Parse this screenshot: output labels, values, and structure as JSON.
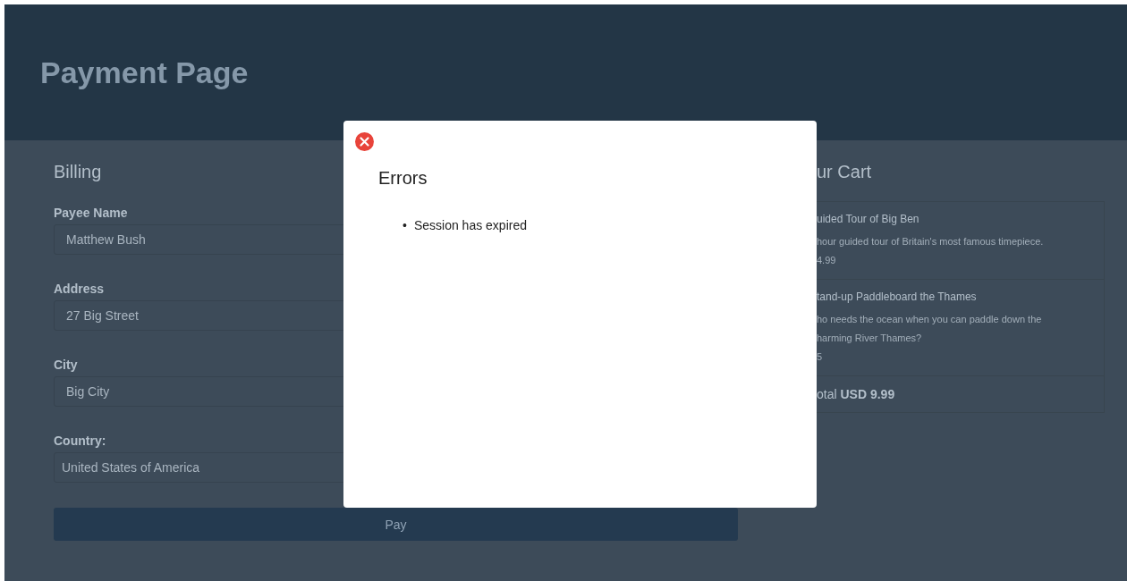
{
  "header": {
    "title": "Payment Page"
  },
  "billing": {
    "heading": "Billing",
    "fields": [
      {
        "label": "Payee Name",
        "value": "Matthew Bush"
      },
      {
        "label": "Address",
        "value": "27 Big Street"
      },
      {
        "label": "City",
        "value": "Big City"
      },
      {
        "label": "Country:",
        "value": "United States of America"
      }
    ],
    "pay_button": "Pay"
  },
  "cart": {
    "heading": "ur Cart",
    "items": [
      {
        "name": "uided Tour of Big Ben",
        "description_lines": [
          "hour guided tour of Britain's most famous timepiece."
        ],
        "price": "4.99"
      },
      {
        "name": "tand-up Paddleboard the Thames",
        "description_lines": [
          "ho needs the ocean when you can paddle down the",
          "harming River Thames?"
        ],
        "price": "5"
      }
    ],
    "total_label": "otal",
    "total_value": "USD 9.99"
  },
  "dialog": {
    "title": "Errors",
    "errors": [
      {
        "marker": "•",
        "text": "Session has expired"
      }
    ]
  }
}
